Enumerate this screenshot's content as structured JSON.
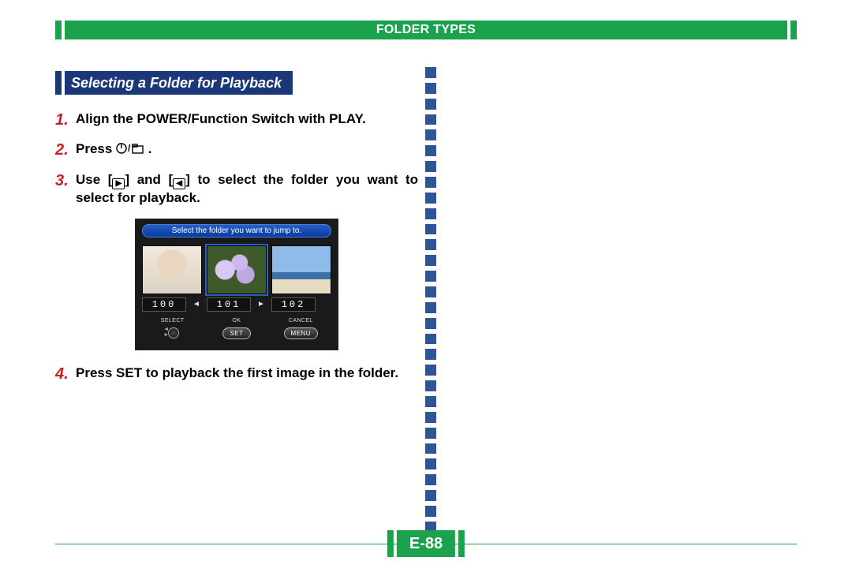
{
  "header": {
    "title": "FOLDER TYPES"
  },
  "section": {
    "title": "Selecting a Folder for Playback"
  },
  "steps": {
    "s1": {
      "num": "1.",
      "text": "Align the POWER/Function Switch with PLAY."
    },
    "s2": {
      "num": "2.",
      "text_prefix": "Press ",
      "text_suffix": " ."
    },
    "s3": {
      "num": "3.",
      "text_prefix": "Use [",
      "text_mid": "] and [",
      "text_suffix": "] to select the folder you want to select for playback."
    },
    "s4": {
      "num": "4.",
      "text": "Press SET to playback the first image in the folder."
    }
  },
  "screenshot": {
    "banner": "Select the folder you want to jump to.",
    "folders": {
      "a": "100",
      "b": "101",
      "c": "102"
    },
    "buttons": {
      "select_label": "SELECT",
      "ok_label": "OK",
      "ok_pill": "SET",
      "cancel_label": "CANCEL",
      "cancel_pill": "MENU"
    }
  },
  "page_number": "E-88"
}
